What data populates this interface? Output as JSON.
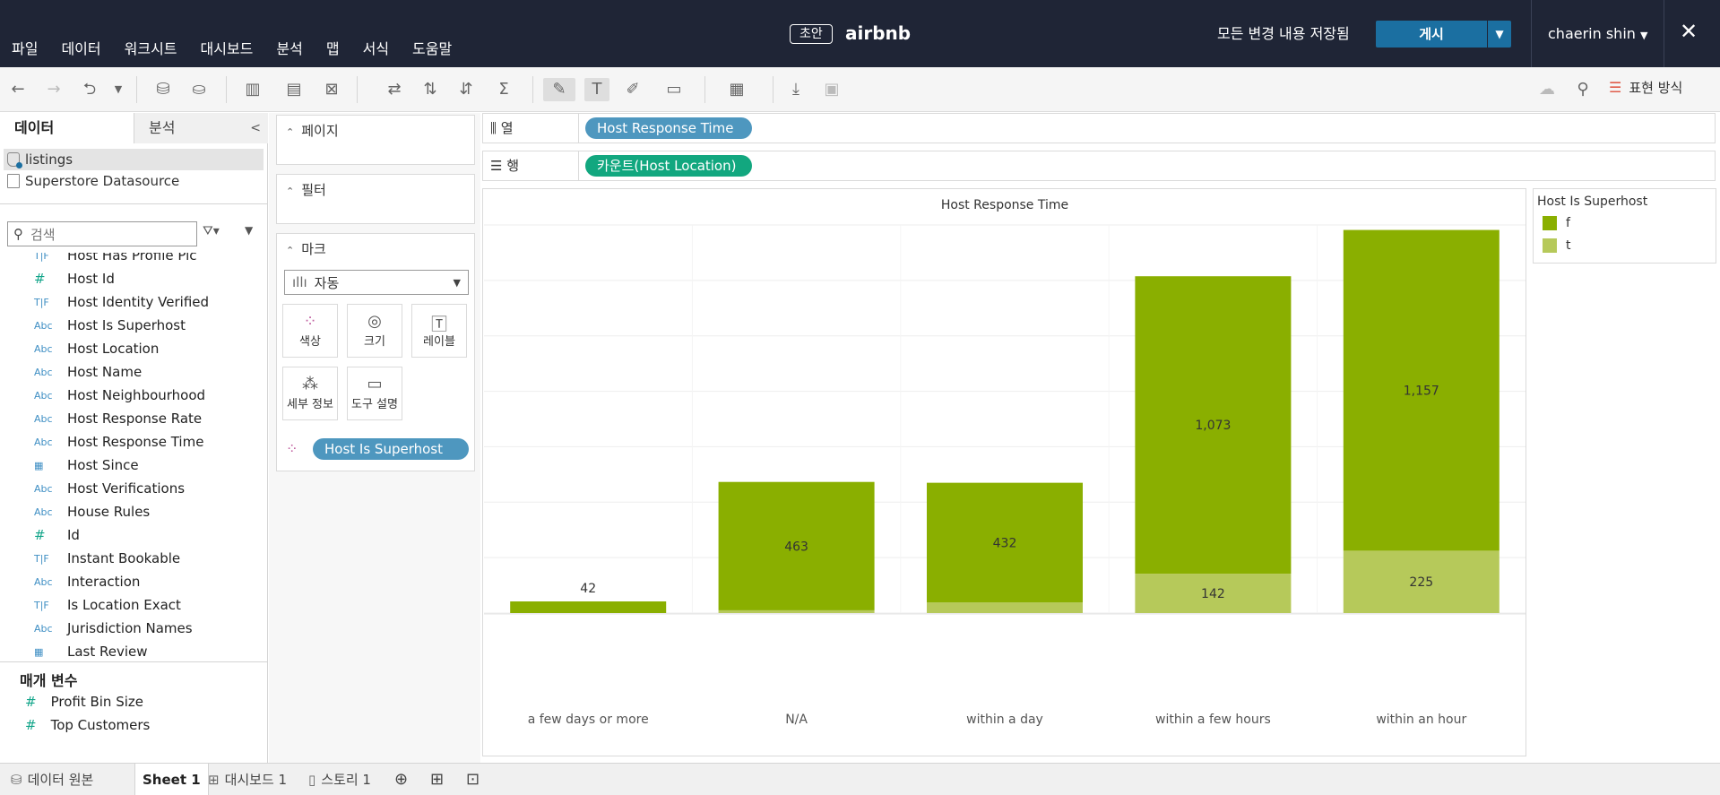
{
  "header": {
    "menu": [
      "파일",
      "데이터",
      "워크시트",
      "대시보드",
      "분석",
      "맵",
      "서식",
      "도움말"
    ],
    "draft_badge": "초안",
    "workbook_title": "airbnb",
    "saved_status": "모든 변경 내용 저장됨",
    "publish_label": "게시",
    "user_name": "chaerin shin",
    "bg_color": "#1f2536",
    "publish_color": "#1b6fa1"
  },
  "toolbar": {
    "show_me_label": "표현 방식"
  },
  "data_pane": {
    "tabs": [
      "데이터",
      "분석"
    ],
    "datasources": [
      "listings",
      "Superstore Datasource"
    ],
    "search_placeholder": "검색",
    "fields": [
      {
        "type": "T|F",
        "name": "Host Has Profile Pic"
      },
      {
        "type": "#",
        "name": "Host Id"
      },
      {
        "type": "T|F",
        "name": "Host Identity Verified"
      },
      {
        "type": "Abc",
        "name": "Host Is Superhost"
      },
      {
        "type": "Abc",
        "name": "Host Location"
      },
      {
        "type": "Abc",
        "name": "Host Name"
      },
      {
        "type": "Abc",
        "name": "Host Neighbourhood"
      },
      {
        "type": "Abc",
        "name": "Host Response Rate"
      },
      {
        "type": "Abc",
        "name": "Host Response Time"
      },
      {
        "type": "date",
        "name": "Host Since"
      },
      {
        "type": "Abc",
        "name": "Host Verifications"
      },
      {
        "type": "Abc",
        "name": "House Rules"
      },
      {
        "type": "#",
        "name": "Id"
      },
      {
        "type": "T|F",
        "name": "Instant Bookable"
      },
      {
        "type": "Abc",
        "name": "Interaction"
      },
      {
        "type": "T|F",
        "name": "Is Location Exact"
      },
      {
        "type": "Abc",
        "name": "Jurisdiction Names"
      },
      {
        "type": "date",
        "name": "Last Review"
      }
    ],
    "parameters_title": "매개 변수",
    "parameters": [
      "Profit Bin Size",
      "Top Customers"
    ]
  },
  "cards": {
    "pages_title": "페이지",
    "filters_title": "필터",
    "marks_title": "마크",
    "mark_type": "자동",
    "mark_buttons": [
      "색상",
      "크기",
      "레이블",
      "세부 정보",
      "도구 설명"
    ],
    "color_pill": "Host Is Superhost"
  },
  "shelves": {
    "columns_label": "열",
    "rows_label": "행",
    "columns_pill": "Host Response Time",
    "rows_pill": "카운트(Host Location)"
  },
  "legend": {
    "title": "Host Is Superhost",
    "items": [
      {
        "label": "f",
        "color": "#8aaf00"
      },
      {
        "label": "t",
        "color": "#b6c95a"
      }
    ]
  },
  "chart_data": {
    "type": "bar",
    "stacked": true,
    "title": "Host Response Time",
    "xlabel": "",
    "ylabel": "",
    "categories": [
      "a few days or more",
      "N/A",
      "within a day",
      "within a few hours",
      "within an hour"
    ],
    "series": [
      {
        "name": "f",
        "values": [
          42,
          463,
          432,
          1073,
          1157
        ],
        "color": "#8aaf00"
      },
      {
        "name": "t",
        "values": [
          0,
          10,
          38,
          142,
          225
        ],
        "color": "#b6c95a"
      }
    ],
    "labels": [
      {
        "category": "a few days or more",
        "series": "f",
        "text": "42"
      },
      {
        "category": "N/A",
        "series": "f",
        "text": "463"
      },
      {
        "category": "within a day",
        "series": "f",
        "text": "432"
      },
      {
        "category": "within a few hours",
        "series": "f",
        "text": "1,073"
      },
      {
        "category": "within a few hours",
        "series": "t",
        "text": "142"
      },
      {
        "category": "within an hour",
        "series": "f",
        "text": "1,157"
      },
      {
        "category": "within an hour",
        "series": "t",
        "text": "225"
      }
    ],
    "ylim": [
      0,
      1400
    ],
    "grid": true,
    "legend_position": "right"
  },
  "bottom_tabs": {
    "datasource_tab": "데이터 원본",
    "sheet_tab": "Sheet 1",
    "dashboard_tab": "대시보드 1",
    "story_tab": "스토리 1"
  }
}
